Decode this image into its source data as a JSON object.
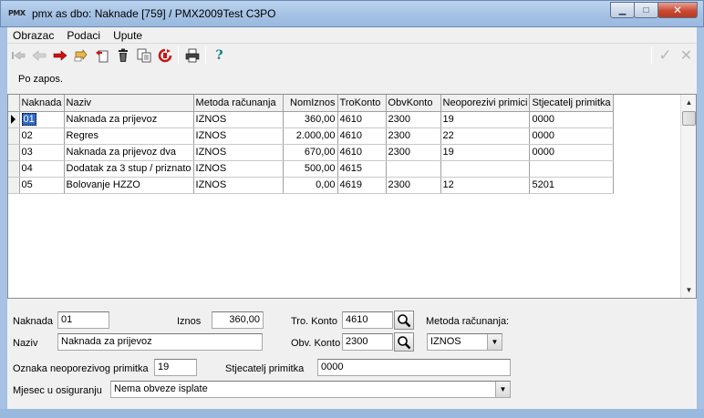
{
  "window": {
    "logo": "PMX",
    "title": "pmx as dbo: Naknade [759] / PMX2009Test C3PO",
    "minimize": "▁",
    "maximize": "□",
    "close": "✕"
  },
  "menu": [
    "Obrazac",
    "Podaci",
    "Upute"
  ],
  "toolbar": {
    "icons": [
      "first-icon",
      "prev-icon",
      "next-icon",
      "last-icon",
      "new-icon",
      "delete-icon",
      "copy-icon",
      "refresh-icon",
      "print-icon",
      "help-icon"
    ],
    "help_glyph": "?",
    "confirm_glyph": "✓",
    "cancel_glyph": "✕"
  },
  "sort_label": "Po zapos.",
  "grid": {
    "columns": [
      "Naknada",
      "Naziv",
      "Metoda računanja",
      "NomIznos",
      "TroKonto",
      "ObvKonto",
      "Neoporezivi primici",
      "Stjecatelj primitka"
    ],
    "rows": [
      [
        "01",
        "Naknada za prijevoz",
        "IZNOS",
        "360,00",
        "4610",
        "2300",
        "19",
        "0000"
      ],
      [
        "02",
        "Regres",
        "IZNOS",
        "2.000,00",
        "4610",
        "2300",
        "22",
        "0000"
      ],
      [
        "03",
        "Naknada za prijevoz dva",
        "IZNOS",
        "670,00",
        "4610",
        "2300",
        "19",
        "0000"
      ],
      [
        "04",
        "Dodatak za 3 stup / priznato",
        "IZNOS",
        "500,00",
        "4615",
        "",
        "",
        ""
      ],
      [
        "05",
        "Bolovanje HZZO",
        "IZNOS",
        "0,00",
        "4619",
        "2300",
        "12",
        "5201"
      ]
    ]
  },
  "form": {
    "naknada_label": "Naknada",
    "naknada_value": "01",
    "iznos_label": "Iznos",
    "iznos_value": "360,00",
    "tro_konto_label": "Tro. Konto",
    "tro_konto_value": "4610",
    "metoda_label": "Metoda računanja:",
    "naziv_label": "Naziv",
    "naziv_value": "Naknada za prijevoz",
    "obv_konto_label": "Obv. Konto",
    "obv_konto_value": "2300",
    "metoda_value": "IZNOS",
    "oznaka_label": "Oznaka neoporezivog primitka",
    "oznaka_value": "19",
    "stjecatelj_label": "Stjecatelj primitka",
    "stjecatelj_value": "0000",
    "mjesec_label": "Mjesec u osiguranju",
    "mjesec_value": "Nema obveze isplate"
  }
}
